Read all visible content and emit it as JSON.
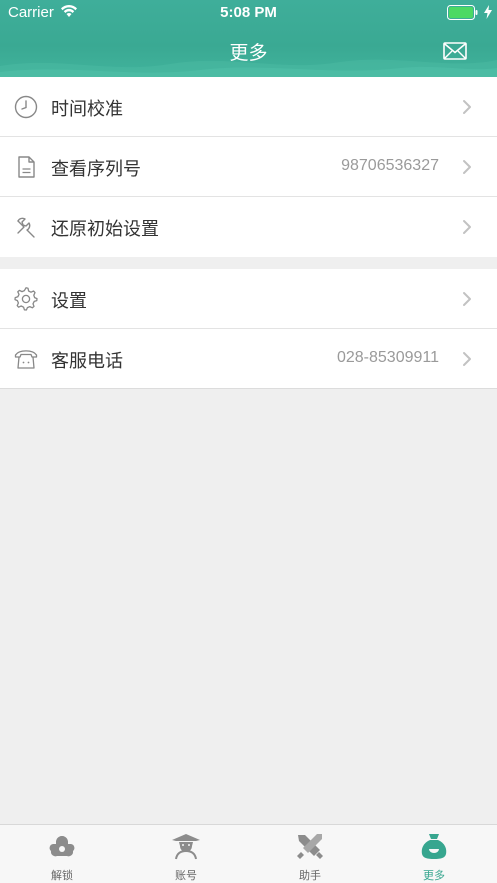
{
  "status_bar": {
    "carrier": "Carrier",
    "time": "5:08 PM"
  },
  "nav": {
    "title": "更多"
  },
  "menu_group_1": [
    {
      "label": "时间校准",
      "value": "",
      "icon": "clock-icon"
    },
    {
      "label": "查看序列号",
      "value": "98706536327",
      "icon": "document-icon"
    },
    {
      "label": "还原初始设置",
      "value": "",
      "icon": "wrench-icon"
    }
  ],
  "menu_group_2": [
    {
      "label": "设置",
      "value": "",
      "icon": "gear-icon"
    },
    {
      "label": "客服电话",
      "value": "028-85309911",
      "icon": "telephone-icon"
    }
  ],
  "tabs": [
    {
      "label": "解锁",
      "icon": "unlock-icon",
      "active": false
    },
    {
      "label": "账号",
      "icon": "account-icon",
      "active": false
    },
    {
      "label": "助手",
      "icon": "assistant-icon",
      "active": false
    },
    {
      "label": "更多",
      "icon": "more-bag-icon",
      "active": true
    }
  ],
  "colors": {
    "accent": "#37a68f",
    "tab_inactive": "#8c8c8c",
    "background": "#efefef"
  }
}
